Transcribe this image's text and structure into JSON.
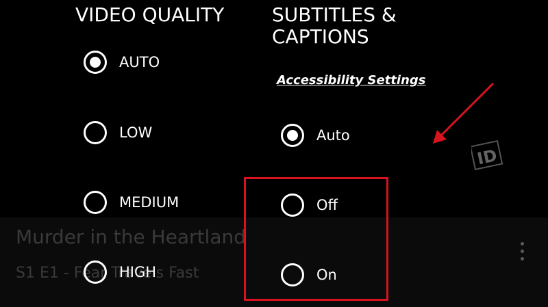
{
  "background_player": {
    "show_title": "Murder in the Heartland",
    "episode_line": "S1 E1 - Fear Travels Fast",
    "more_icon": "more-vertical-icon",
    "watermark": "ID"
  },
  "video_quality": {
    "heading": "VIDEO QUALITY",
    "options": [
      {
        "label": "AUTO",
        "selected": true
      },
      {
        "label": "LOW",
        "selected": false
      },
      {
        "label": "MEDIUM",
        "selected": false
      },
      {
        "label": "HIGH",
        "selected": false
      }
    ]
  },
  "subtitles": {
    "heading_line1": "SUBTITLES &",
    "heading_line2": "CAPTIONS",
    "accessibility_link": "Accessibility Settings",
    "options": [
      {
        "label": "Auto",
        "selected": true
      },
      {
        "label": "Off",
        "selected": false
      },
      {
        "label": "On",
        "selected": false
      }
    ]
  },
  "annotation": {
    "highlight_color": "#d8131f",
    "arrow_color": "#d8131f"
  }
}
